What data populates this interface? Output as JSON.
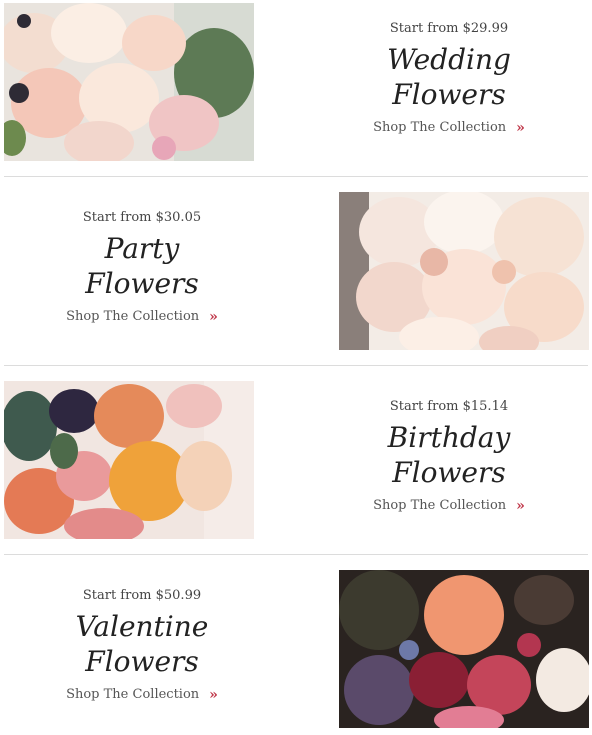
{
  "collections": [
    {
      "price": "Start from $29.99",
      "title_line1": "Wedding",
      "title_line2": "Flowers",
      "cta": "Shop The Collection",
      "icon": "chevron-double-right-icon"
    },
    {
      "price": "Start from $30.05",
      "title_line1": "Party",
      "title_line2": "Flowers",
      "cta": "Shop The Collection",
      "icon": "chevron-double-right-icon"
    },
    {
      "price": "Start from $15.14",
      "title_line1": "Birthday",
      "title_line2": "Flowers",
      "cta": "Shop The Collection",
      "icon": "chevron-double-right-icon"
    },
    {
      "price": "Start from $50.99",
      "title_line1": "Valentine",
      "title_line2": "Flowers",
      "cta": "Shop The Collection",
      "icon": "chevron-double-right-icon"
    }
  ],
  "colors": {
    "accent": "#c0394b",
    "divider": "#dcdcdc",
    "text": "#333333"
  }
}
